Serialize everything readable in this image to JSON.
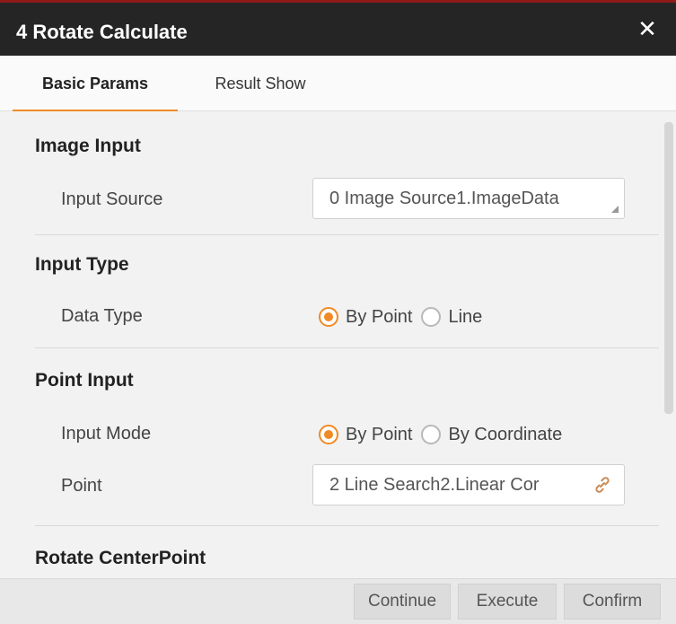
{
  "window": {
    "title": "4 Rotate Calculate",
    "close_icon": "close-icon"
  },
  "tabs": [
    {
      "label": "Basic Params",
      "active": true
    },
    {
      "label": "Result Show",
      "active": false
    }
  ],
  "sections": {
    "image_input": {
      "title": "Image Input",
      "input_source_label": "Input Source",
      "input_source_value": "0 Image Source1.ImageData"
    },
    "input_type": {
      "title": "Input Type",
      "data_type_label": "Data Type",
      "options": [
        "By Point",
        "Line"
      ],
      "selected": "By Point"
    },
    "point_input": {
      "title": "Point Input",
      "input_mode_label": "Input Mode",
      "options": [
        "By Point",
        "By Coordinate"
      ],
      "selected": "By Point",
      "point_label": "Point",
      "point_value": "2 Line Search2.Linear Cor"
    },
    "rotate_center": {
      "title": "Rotate CenterPoint"
    }
  },
  "footer": {
    "continue_label": "Continue",
    "execute_label": "Execute",
    "confirm_label": "Confirm"
  },
  "colors": {
    "accent": "#f08a24",
    "titlebar": "#252525"
  }
}
